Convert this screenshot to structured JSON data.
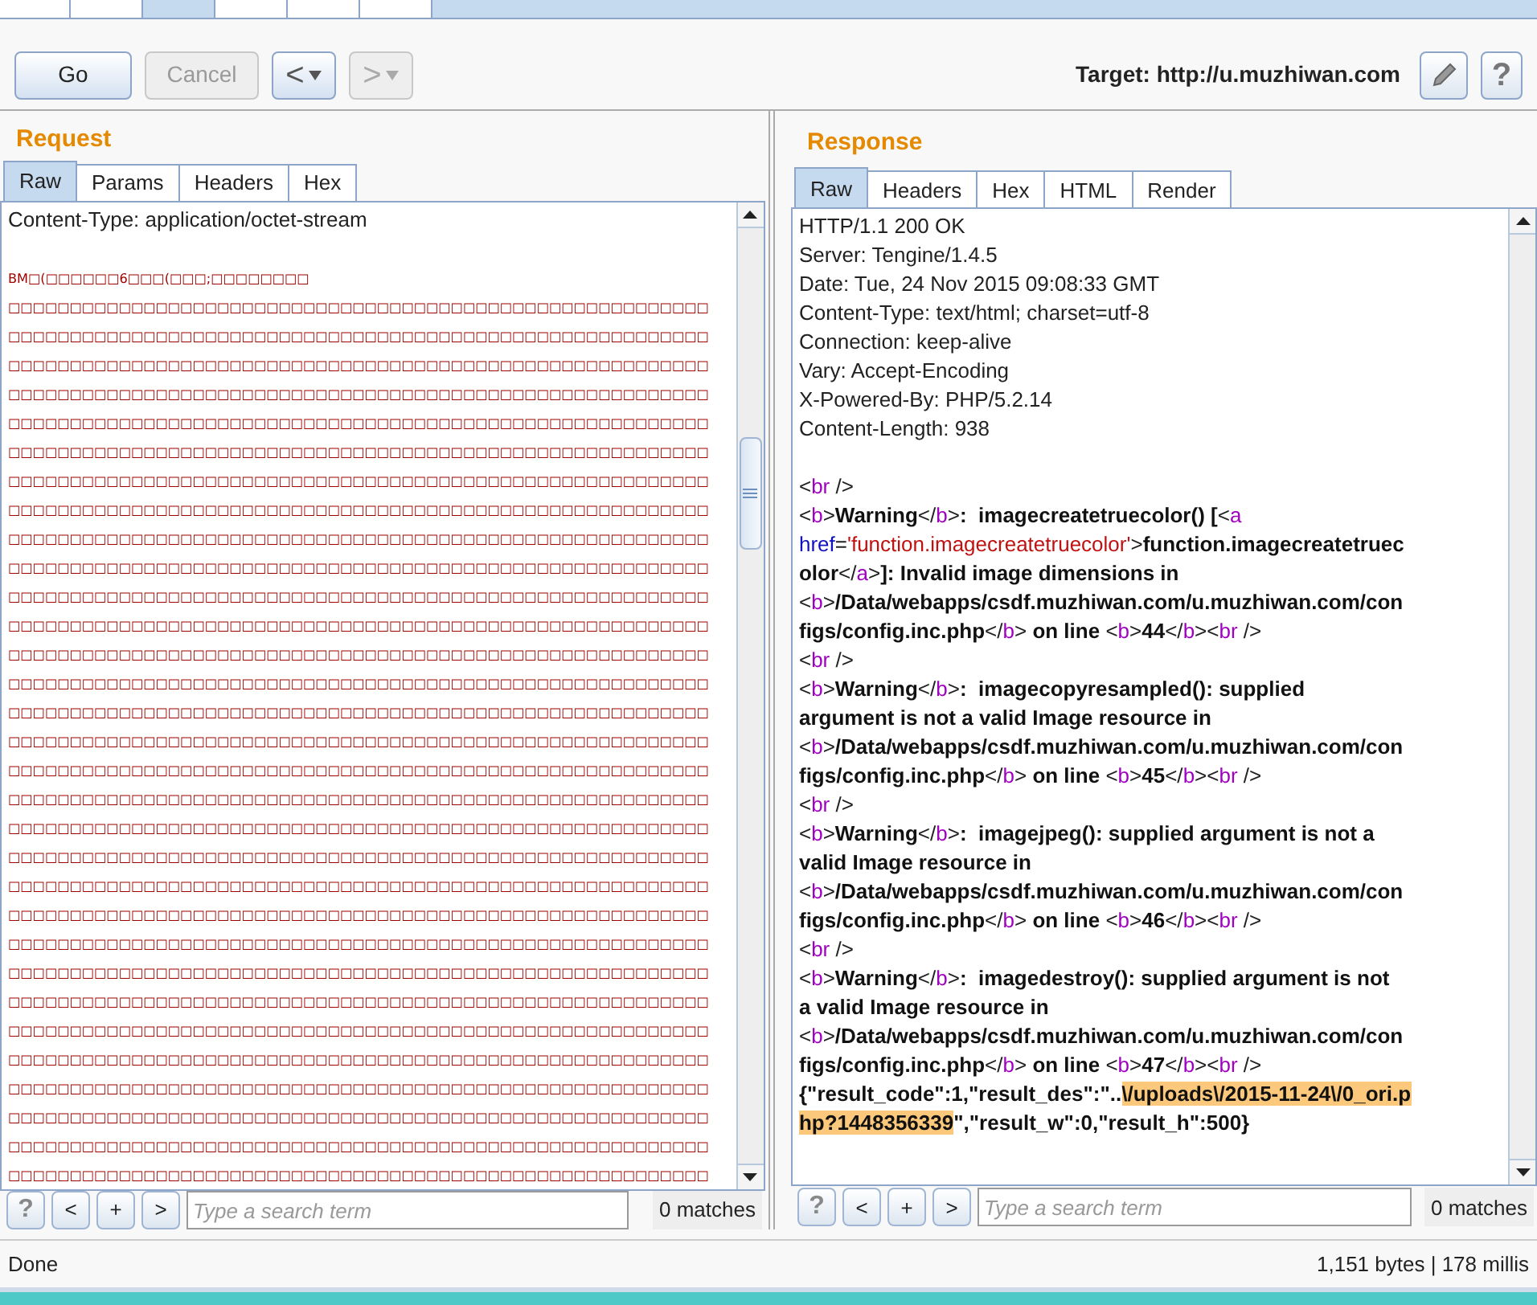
{
  "top_tabs": [
    {
      "selected": false
    },
    {
      "selected": false
    },
    {
      "selected": true
    },
    {
      "selected": false
    },
    {
      "selected": false
    },
    {
      "selected": false
    }
  ],
  "toolbar": {
    "go": "Go",
    "cancel": {
      "label": "Cancel",
      "disabled": true
    },
    "back": {
      "label": "<",
      "disabled": false
    },
    "forward": {
      "label": ">",
      "disabled": true
    },
    "target": "Target: http://u.muzhiwan.com",
    "help": "?"
  },
  "request": {
    "title": "Request",
    "tabs": [
      {
        "label": "Raw",
        "selected": true
      },
      {
        "label": "Params",
        "selected": false
      },
      {
        "label": "Headers",
        "selected": false
      },
      {
        "label": "Hex",
        "selected": false
      }
    ],
    "header_line": "Content-Type: application/octet-stream",
    "body_lines": [
      "BM□(□□□□□□6□□□(□□□;□□□□□□□□",
      "□□□□□□□□□□□□□□□□□□□□□□□□□□□□□□□□□□□□□□□□□□□□□□□□□□□□□□□□□",
      "□□□□□□□□□□□□□□□□□□□□□□□□□□□□□□□□□□□□□□□□□□□□□□□□□□□□□□□□□",
      "□□□□□□□□□□□□□□□□□□□□□□□□□□□□□□□□□□□□□□□□□□□□□□□□□□□□□□□□□",
      "□□□□□□□□□□□□□□□□□□□□□□□□□□□□□□□□□□□□□□□□□□□□□□□□□□□□□□□□□",
      "□□□□□□□□□□□□□□□□□□□□□□□□□□□□□□□□□□□□□□□□□□□□□□□□□□□□□□□□□",
      "□□□□□□□□□□□□□□□□□□□□□□□□□□□□□□□□□□□□□□□□□□□□□□□□□□□□□□□□□",
      "□□□□□□□□□□□□□□□□□□□□□□□□□□□□□□□□□□□□□□□□□□□□□□□□□□□□□□□□□",
      "□□□□□□□□□□□□□□□□□□□□□□□□□□□□□□□□□□□□□□□□□□□□□□□□□□□□□□□□□",
      "□□□□□□□□□□□□□□□□□□□□□□□□□□□□□□□□□□□□□□□□□□□□□□□□□□□□□□□□□",
      "□□□□□□□□□□□□□□□□□□□□□□□□□□□□□□□□□□□□□□□□□□□□□□□□□□□□□□□□□",
      "□□□□□□□□□□□□□□□□□□□□□□□□□□□□□□□□□□□□□□□□□□□□□□□□□□□□□□□□□",
      "□□□□□□□□□□□□□□□□□□□□□□□□□□□□□□□□□□□□□□□□□□□□□□□□□□□□□□□□□",
      "□□□□□□□□□□□□□□□□□□□□□□□□□□□□□□□□□□□□□□□□□□□□□□□□□□□□□□□□□",
      "□□□□□□□□□□□□□□□□□□□□□□□□□□□□□□□□□□□□□□□□□□□□□□□□□□□□□□□□□",
      "□□□□□□□□□□□□□□□□□□□□□□□□□□□□□□□□□□□□□□□□□□□□□□□□□□□□□□□□□",
      "□□□□□□□□□□□□□□□□□□□□□□□□□□□□□□□□□□□□□□□□□□□□□□□□□□□□□□□□□",
      "□□□□□□□□□□□□□□□□□□□□□□□□□□□□□□□□□□□□□□□□□□□□□□□□□□□□□□□□□",
      "□□□□□□□□□□□□□□□□□□□□□□□□□□□□□□□□□□□□□□□□□□□□□□□□□□□□□□□□□",
      "□□□□□□□□□□□□□□□□□□□□□□□□□□□□□□□□□□□□□□□□□□□□□□□□□□□□□□□□□",
      "□□□□□□□□□□□□□□□□□□□□□□□□□□□□□□□□□□□□□□□□□□□□□□□□□□□□□□□□□",
      "□□□□□□□□□□□□□□□□□□□□□□□□□□□□□□□□□□□□□□□□□□□□□□□□□□□□□□□□□",
      "□□□□□□□□□□□□□□□□□□□□□□□□□□□□□□□□□□□□□□□□□□□□□□□□□□□□□□□□□",
      "□□□□□□□□□□□□□□□□□□□□□□□□□□□□□□□□□□□□□□□□□□□□□□□□□□□□□□□□□",
      "□□□□□□□□□□□□□□□□□□□□□□□□□□□□□□□□□□□□□□□□□□□□□□□□□□□□□□□□□",
      "□□□□□□□□□□□□□□□□□□□□□□□□□□□□□□□□□□□□□□□□□□□□□□□□□□□□□□□□□",
      "□□□□□□□□□□□□□□□□□□□□□□□□□□□□□□□□□□□□□□□□□□□□□□□□□□□□□□□□□",
      "□□□□□□□□□□□□□□□□□□□□□□□□□□□□□□□□□□□□□□□□□□□□□□□□□□□□□□□□□",
      "□□□□□□□□□□□□□□□□□□□□□□□□□□□□□□□□□□□□□□□□□□□□□□□□□□□□□□□□□",
      "□□□□□□□□□□□□□□□□□□□□□□□□□□□□□□□□□□□□□□□□□□□□□□□□□□□□□□□□□",
      "□□□□□□□□□□□□□□□□□□□□□□□□□□□□□□□□□□□□□□□□□□□□□□□□□□□□□□□□□",
      "□□□□□□□□□□□□□□□□□□□□□□□□□□□□□□□□□□□□□□□□□□□□□□□□□□□□□□□□□"
    ],
    "search": {
      "help": "?",
      "prev": "<",
      "add": "+",
      "next": ">",
      "placeholder": "Type a search term",
      "matches": "0 matches"
    }
  },
  "response": {
    "title": "Response",
    "tabs": [
      {
        "label": "Raw",
        "selected": true
      },
      {
        "label": "Headers",
        "selected": false
      },
      {
        "label": "Hex",
        "selected": false
      },
      {
        "label": "HTML",
        "selected": false
      },
      {
        "label": "Render",
        "selected": false
      }
    ],
    "headers": [
      "HTTP/1.1 200 OK",
      "Server: Tengine/1.4.5",
      "Date: Tue, 24 Nov 2015 09:08:33 GMT",
      "Content-Type: text/html; charset=utf-8",
      "Connection: keep-alive",
      "Vary: Accept-Encoding",
      "X-Powered-By: PHP/5.2.14",
      "Content-Length: 938"
    ],
    "body": [
      [
        {
          "kind": "punct",
          "text": "<"
        },
        {
          "kind": "tag",
          "text": "br"
        },
        {
          "kind": "punct",
          "text": " />"
        }
      ],
      [
        {
          "kind": "punct",
          "text": "<"
        },
        {
          "kind": "tag",
          "text": "b"
        },
        {
          "kind": "punct",
          "text": ">"
        },
        {
          "kind": "bold",
          "text": "Warning"
        },
        {
          "kind": "punct",
          "text": "</"
        },
        {
          "kind": "tag",
          "text": "b"
        },
        {
          "kind": "punct",
          "text": ">"
        },
        {
          "kind": "bold",
          "text": ":  imagecreatetruecolor() ["
        },
        {
          "kind": "punct",
          "text": "<"
        },
        {
          "kind": "tag",
          "text": "a"
        }
      ],
      [
        {
          "kind": "attr",
          "text": "href"
        },
        {
          "kind": "punct",
          "text": "="
        },
        {
          "kind": "value",
          "text": "'function.imagecreatetruecolor'"
        },
        {
          "kind": "punct",
          "text": ">"
        },
        {
          "kind": "bold",
          "text": "function.imagecreatetruec"
        }
      ],
      [
        {
          "kind": "bold",
          "text": "olor"
        },
        {
          "kind": "punct",
          "text": "</"
        },
        {
          "kind": "tag",
          "text": "a"
        },
        {
          "kind": "punct",
          "text": ">"
        },
        {
          "kind": "bold",
          "text": "]: Invalid image dimensions in"
        }
      ],
      [
        {
          "kind": "punct",
          "text": "<"
        },
        {
          "kind": "tag",
          "text": "b"
        },
        {
          "kind": "punct",
          "text": ">"
        },
        {
          "kind": "bold",
          "text": "/Data/webapps/csdf.muzhiwan.com/u.muzhiwan.com/con"
        }
      ],
      [
        {
          "kind": "bold",
          "text": "figs/config.inc.php"
        },
        {
          "kind": "punct",
          "text": "</"
        },
        {
          "kind": "tag",
          "text": "b"
        },
        {
          "kind": "punct",
          "text": ">"
        },
        {
          "kind": "bold",
          "text": " on line "
        },
        {
          "kind": "punct",
          "text": "<"
        },
        {
          "kind": "tag",
          "text": "b"
        },
        {
          "kind": "punct",
          "text": ">"
        },
        {
          "kind": "bold",
          "text": "44"
        },
        {
          "kind": "punct",
          "text": "</"
        },
        {
          "kind": "tag",
          "text": "b"
        },
        {
          "kind": "punct",
          "text": "><"
        },
        {
          "kind": "tag",
          "text": "br"
        },
        {
          "kind": "punct",
          "text": " />"
        }
      ],
      [
        {
          "kind": "punct",
          "text": "<"
        },
        {
          "kind": "tag",
          "text": "br"
        },
        {
          "kind": "punct",
          "text": " />"
        }
      ],
      [
        {
          "kind": "punct",
          "text": "<"
        },
        {
          "kind": "tag",
          "text": "b"
        },
        {
          "kind": "punct",
          "text": ">"
        },
        {
          "kind": "bold",
          "text": "Warning"
        },
        {
          "kind": "punct",
          "text": "</"
        },
        {
          "kind": "tag",
          "text": "b"
        },
        {
          "kind": "punct",
          "text": ">"
        },
        {
          "kind": "bold",
          "text": ":  imagecopyresampled(): supplied"
        }
      ],
      [
        {
          "kind": "bold",
          "text": "argument is not a valid Image resource in"
        }
      ],
      [
        {
          "kind": "punct",
          "text": "<"
        },
        {
          "kind": "tag",
          "text": "b"
        },
        {
          "kind": "punct",
          "text": ">"
        },
        {
          "kind": "bold",
          "text": "/Data/webapps/csdf.muzhiwan.com/u.muzhiwan.com/con"
        }
      ],
      [
        {
          "kind": "bold",
          "text": "figs/config.inc.php"
        },
        {
          "kind": "punct",
          "text": "</"
        },
        {
          "kind": "tag",
          "text": "b"
        },
        {
          "kind": "punct",
          "text": ">"
        },
        {
          "kind": "bold",
          "text": " on line "
        },
        {
          "kind": "punct",
          "text": "<"
        },
        {
          "kind": "tag",
          "text": "b"
        },
        {
          "kind": "punct",
          "text": ">"
        },
        {
          "kind": "bold",
          "text": "45"
        },
        {
          "kind": "punct",
          "text": "</"
        },
        {
          "kind": "tag",
          "text": "b"
        },
        {
          "kind": "punct",
          "text": "><"
        },
        {
          "kind": "tag",
          "text": "br"
        },
        {
          "kind": "punct",
          "text": " />"
        }
      ],
      [
        {
          "kind": "punct",
          "text": "<"
        },
        {
          "kind": "tag",
          "text": "br"
        },
        {
          "kind": "punct",
          "text": " />"
        }
      ],
      [
        {
          "kind": "punct",
          "text": "<"
        },
        {
          "kind": "tag",
          "text": "b"
        },
        {
          "kind": "punct",
          "text": ">"
        },
        {
          "kind": "bold",
          "text": "Warning"
        },
        {
          "kind": "punct",
          "text": "</"
        },
        {
          "kind": "tag",
          "text": "b"
        },
        {
          "kind": "punct",
          "text": ">"
        },
        {
          "kind": "bold",
          "text": ":  imagejpeg(): supplied argument is not a"
        }
      ],
      [
        {
          "kind": "bold",
          "text": "valid Image resource in"
        }
      ],
      [
        {
          "kind": "punct",
          "text": "<"
        },
        {
          "kind": "tag",
          "text": "b"
        },
        {
          "kind": "punct",
          "text": ">"
        },
        {
          "kind": "bold",
          "text": "/Data/webapps/csdf.muzhiwan.com/u.muzhiwan.com/con"
        }
      ],
      [
        {
          "kind": "bold",
          "text": "figs/config.inc.php"
        },
        {
          "kind": "punct",
          "text": "</"
        },
        {
          "kind": "tag",
          "text": "b"
        },
        {
          "kind": "punct",
          "text": ">"
        },
        {
          "kind": "bold",
          "text": " on line "
        },
        {
          "kind": "punct",
          "text": "<"
        },
        {
          "kind": "tag",
          "text": "b"
        },
        {
          "kind": "punct",
          "text": ">"
        },
        {
          "kind": "bold",
          "text": "46"
        },
        {
          "kind": "punct",
          "text": "</"
        },
        {
          "kind": "tag",
          "text": "b"
        },
        {
          "kind": "punct",
          "text": "><"
        },
        {
          "kind": "tag",
          "text": "br"
        },
        {
          "kind": "punct",
          "text": " />"
        }
      ],
      [
        {
          "kind": "punct",
          "text": "<"
        },
        {
          "kind": "tag",
          "text": "br"
        },
        {
          "kind": "punct",
          "text": " />"
        }
      ],
      [
        {
          "kind": "punct",
          "text": "<"
        },
        {
          "kind": "tag",
          "text": "b"
        },
        {
          "kind": "punct",
          "text": ">"
        },
        {
          "kind": "bold",
          "text": "Warning"
        },
        {
          "kind": "punct",
          "text": "</"
        },
        {
          "kind": "tag",
          "text": "b"
        },
        {
          "kind": "punct",
          "text": ">"
        },
        {
          "kind": "bold",
          "text": ":  imagedestroy(): supplied argument is not"
        }
      ],
      [
        {
          "kind": "bold",
          "text": "a valid Image resource in"
        }
      ],
      [
        {
          "kind": "punct",
          "text": "<"
        },
        {
          "kind": "tag",
          "text": "b"
        },
        {
          "kind": "punct",
          "text": ">"
        },
        {
          "kind": "bold",
          "text": "/Data/webapps/csdf.muzhiwan.com/u.muzhiwan.com/con"
        }
      ],
      [
        {
          "kind": "bold",
          "text": "figs/config.inc.php"
        },
        {
          "kind": "punct",
          "text": "</"
        },
        {
          "kind": "tag",
          "text": "b"
        },
        {
          "kind": "punct",
          "text": ">"
        },
        {
          "kind": "bold",
          "text": " on line "
        },
        {
          "kind": "punct",
          "text": "<"
        },
        {
          "kind": "tag",
          "text": "b"
        },
        {
          "kind": "punct",
          "text": ">"
        },
        {
          "kind": "bold",
          "text": "47"
        },
        {
          "kind": "punct",
          "text": "</"
        },
        {
          "kind": "tag",
          "text": "b"
        },
        {
          "kind": "punct",
          "text": "><"
        },
        {
          "kind": "tag",
          "text": "br"
        },
        {
          "kind": "punct",
          "text": " />"
        }
      ],
      [
        {
          "kind": "bold",
          "text": "{\"result_code\":1,\"result_des\":\".."
        },
        {
          "kind": "highlight",
          "text": "\\/uploads\\/2015-11-24\\/0_ori.p"
        }
      ],
      [
        {
          "kind": "highlight",
          "text": "hp?1448356339"
        },
        {
          "kind": "bold",
          "text": "\",\"result_w\":0,\"result_h\":500}"
        }
      ]
    ],
    "search": {
      "help": "?",
      "prev": "<",
      "add": "+",
      "next": ">",
      "placeholder": "Type a search term",
      "matches": "0 matches"
    }
  },
  "status_bar": {
    "left": "Done",
    "right": "1,151 bytes | 178 millis"
  }
}
